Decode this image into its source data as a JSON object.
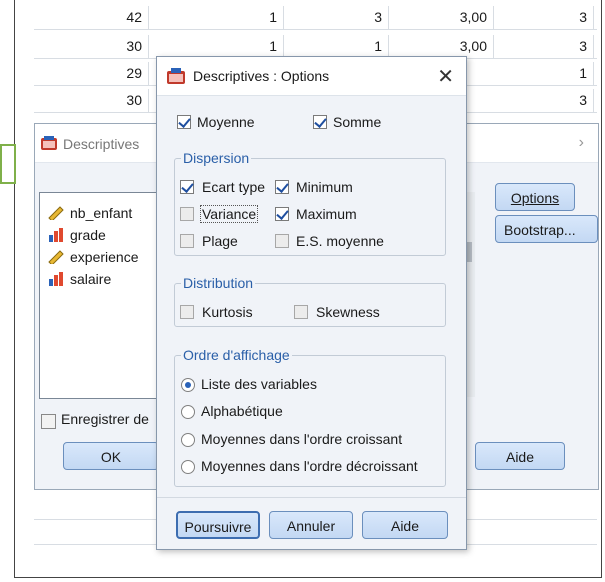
{
  "spreadsheet": {
    "rows": [
      [
        "42",
        "1",
        "3",
        "3,00",
        "3"
      ],
      [
        "30",
        "1",
        "1",
        "3,00",
        "3"
      ],
      [
        "29",
        "",
        "",
        "",
        "1"
      ],
      [
        "30",
        "",
        "",
        "",
        "3"
      ]
    ]
  },
  "descriptives": {
    "title": "Descriptives",
    "variables": [
      {
        "name": "nb_enfant",
        "icon": "ruler-icon"
      },
      {
        "name": "grade",
        "icon": "bar-chart-icon"
      },
      {
        "name": "experience",
        "icon": "ruler-icon"
      },
      {
        "name": "salaire",
        "icon": "bar-chart-icon"
      }
    ],
    "options_button": "Options",
    "bootstrap_button": "Bootstrap...",
    "save_label": "Enregistrer de",
    "ok_button": "OK",
    "help_button": "Aide"
  },
  "options_dialog": {
    "title": "Descriptives : Options",
    "close_glyph": "✕",
    "mean": {
      "label": "Moyenne",
      "checked": true
    },
    "sum": {
      "label": "Somme",
      "checked": true
    },
    "dispersion": {
      "legend": "Dispersion",
      "std_dev": {
        "label": "Ecart type",
        "checked": true
      },
      "minimum": {
        "label": "Minimum",
        "checked": true
      },
      "variance": {
        "label": "Variance",
        "checked": false
      },
      "maximum": {
        "label": "Maximum",
        "checked": true
      },
      "range": {
        "label": "Plage",
        "checked": false
      },
      "se_mean": {
        "label": "E.S. moyenne",
        "checked": false
      }
    },
    "distribution": {
      "legend": "Distribution",
      "kurtosis": {
        "label": "Kurtosis",
        "checked": false
      },
      "skewness": {
        "label": "Skewness",
        "checked": false
      }
    },
    "display_order": {
      "legend": "Ordre d'affichage",
      "options": [
        {
          "label": "Liste des variables",
          "selected": true
        },
        {
          "label": "Alphabétique",
          "selected": false
        },
        {
          "label": "Moyennes dans l'ordre croissant",
          "selected": false
        },
        {
          "label": "Moyennes dans l'ordre décroissant",
          "selected": false
        }
      ]
    },
    "buttons": {
      "continue": "Poursuivre",
      "cancel": "Annuler",
      "help": "Aide"
    }
  },
  "colors": {
    "accent": "#2a5fa8",
    "button_fill": "#c3d8f3",
    "marker": "#7fb04a"
  }
}
